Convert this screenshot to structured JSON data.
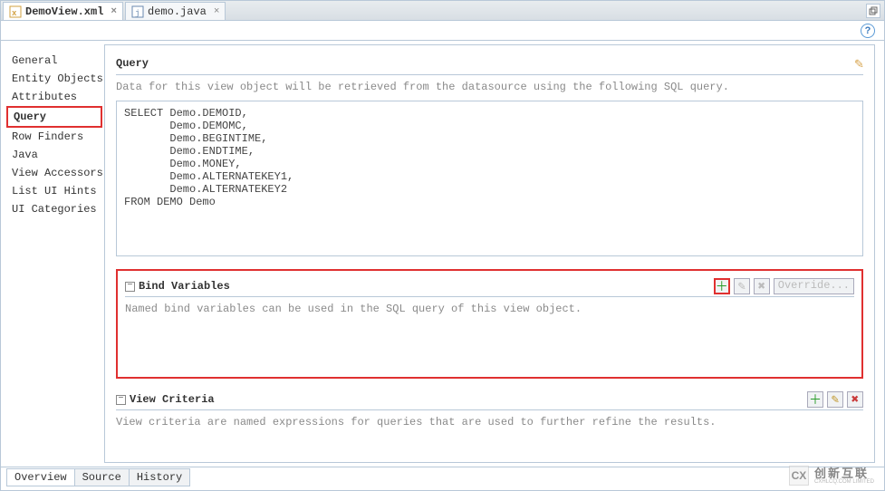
{
  "tabs": {
    "file1": {
      "label": "DemoView.xml"
    },
    "file2": {
      "label": "demo.java"
    }
  },
  "sidebar": {
    "items": [
      {
        "label": "General"
      },
      {
        "label": "Entity Objects"
      },
      {
        "label": "Attributes"
      },
      {
        "label": "Query"
      },
      {
        "label": "Row Finders"
      },
      {
        "label": "Java"
      },
      {
        "label": "View Accessors"
      },
      {
        "label": "List UI Hints"
      },
      {
        "label": "UI Categories"
      }
    ]
  },
  "query_section": {
    "title": "Query",
    "description": "Data for this view object will be retrieved from the datasource using the following SQL query.",
    "sql": "SELECT Demo.DEMOID,\n       Demo.DEMOMC,\n       Demo.BEGINTIME,\n       Demo.ENDTIME,\n       Demo.MONEY,\n       Demo.ALTERNATEKEY1,\n       Demo.ALTERNATEKEY2\nFROM DEMO Demo"
  },
  "bind_section": {
    "title": "Bind Variables",
    "description": "Named bind variables can be used in the SQL query of this view object.",
    "override_label": "Override..."
  },
  "criteria_section": {
    "title": "View Criteria",
    "description": "View criteria are named expressions for queries that are used to further refine the results."
  },
  "bottom_tabs": {
    "overview": "Overview",
    "source": "Source",
    "history": "History"
  },
  "watermark": {
    "logo": "CX",
    "line1": "创新互联",
    "line2": "CXHLCQ.COM LIMITED"
  }
}
